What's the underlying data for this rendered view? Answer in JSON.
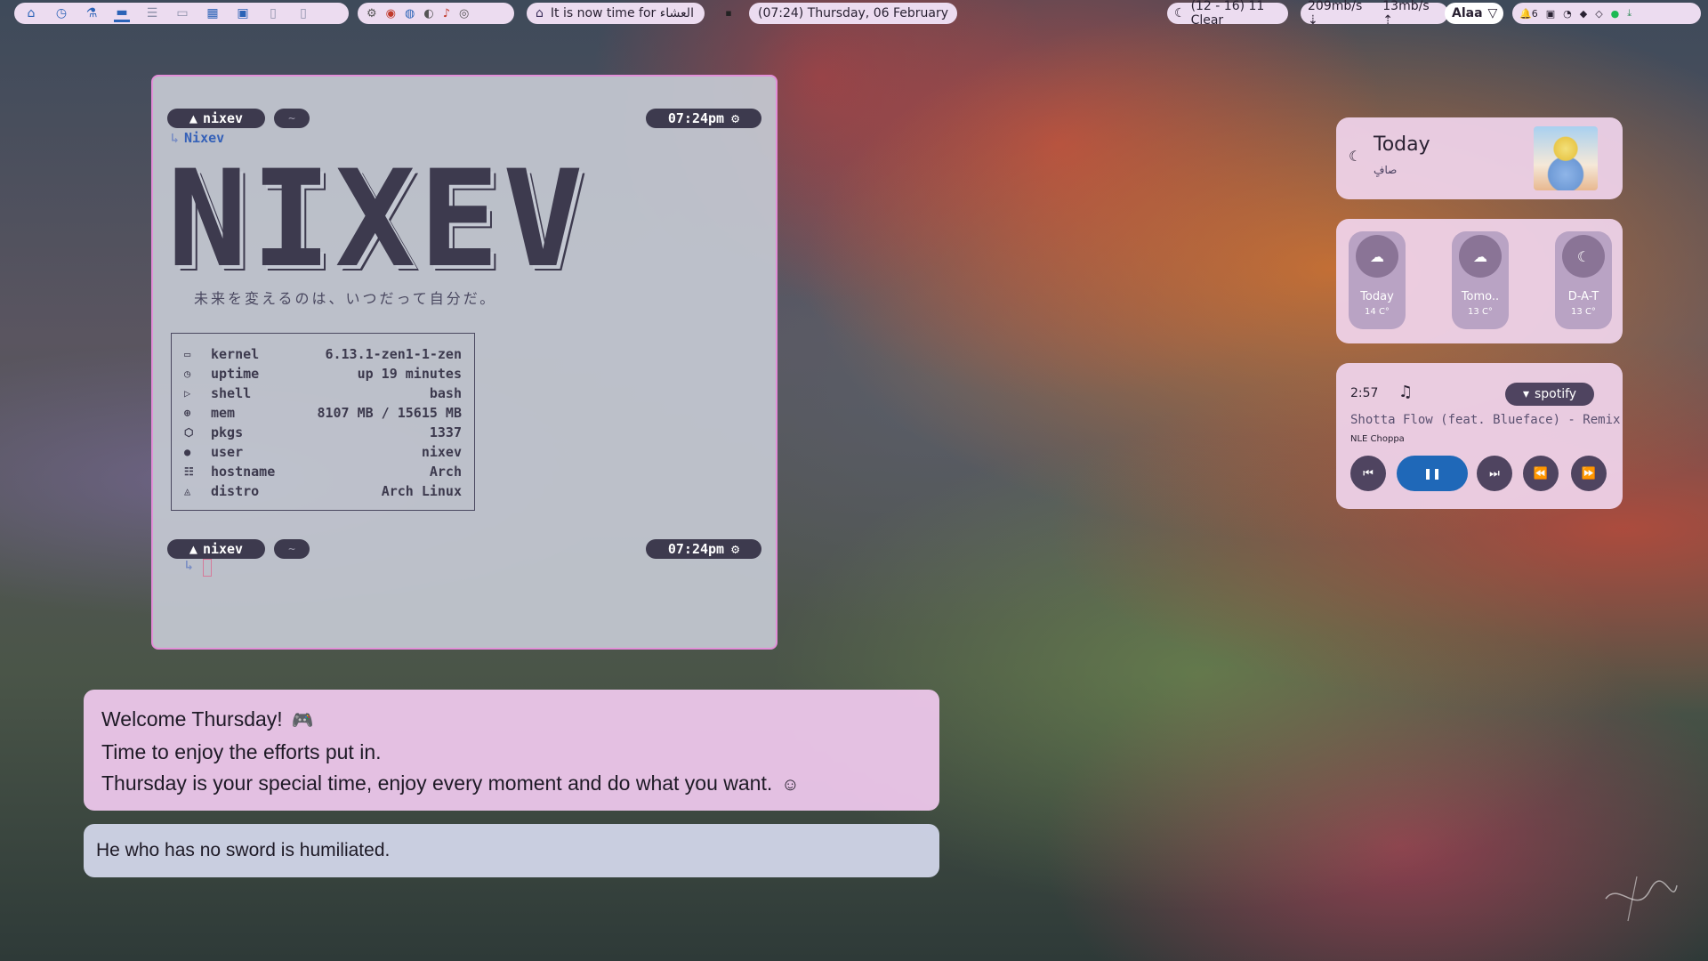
{
  "topbar": {
    "workspace_icons": [
      "home-icon",
      "clock-icon",
      "flask-icon",
      "folder-icon",
      "list-icon",
      "chat-icon",
      "calendar-icon",
      "game-icon",
      "file-icon",
      "phone-icon"
    ],
    "active_workspace": 3,
    "prayer_text": "It is now time for العشاء",
    "clock_text": "(07:24) Thursday, 06 February",
    "weather_text": "(12 - 16) 11 Clear",
    "net_down": "209mb/s",
    "net_up": "13mb/s",
    "user_name": "Alaa",
    "notif_count": "6"
  },
  "terminal": {
    "prompt_user": "nixev",
    "prompt_dir": "~",
    "prompt_time": "07:24pm",
    "command": "Nixev",
    "logo": "NIXEV",
    "tagline": "未来を変えるのは、いつだって自分だ。",
    "sysinfo": [
      {
        "icon": "laptop-icon",
        "key": "kernel",
        "value": "6.13.1-zen1-1-zen"
      },
      {
        "icon": "clock-icon",
        "key": "uptime",
        "value": "up 19 minutes"
      },
      {
        "icon": "terminal-icon",
        "key": "shell",
        "value": "bash"
      },
      {
        "icon": "memory-icon",
        "key": "mem",
        "value": "8107 MB / 15615 MB"
      },
      {
        "icon": "package-icon",
        "key": "pkgs",
        "value": "1337"
      },
      {
        "icon": "user-icon",
        "key": "user",
        "value": "nixev"
      },
      {
        "icon": "hostname-icon",
        "key": "hostname",
        "value": "Arch"
      },
      {
        "icon": "linux-icon",
        "key": "distro",
        "value": "Arch Linux"
      }
    ]
  },
  "today": {
    "title": "Today",
    "subtitle": "صافٍ"
  },
  "forecast": [
    {
      "name": "Today",
      "temp": "14 C°"
    },
    {
      "name": "Tomo..",
      "temp": "13 C°"
    },
    {
      "name": "D-A-T",
      "temp": "13 C°"
    }
  ],
  "music": {
    "time": "2:57",
    "source": "spotify",
    "title": "Shotta Flow (feat. Blueface) - Remix",
    "artist": "NLE Choppa"
  },
  "welcome": {
    "line1": "Welcome Thursday!",
    "line2": "Time to enjoy the efforts put in.",
    "line3": "Thursday is your special time, enjoy every moment and do what you want."
  },
  "quote": "He who has no sword is humiliated.",
  "colors": {
    "accent_blue": "#2b63b7",
    "pill_bg": "#ecdcf0",
    "terminal_border": "#e28fd8",
    "card_pink": "#f0d4ec",
    "play_button": "#1f68b8"
  }
}
